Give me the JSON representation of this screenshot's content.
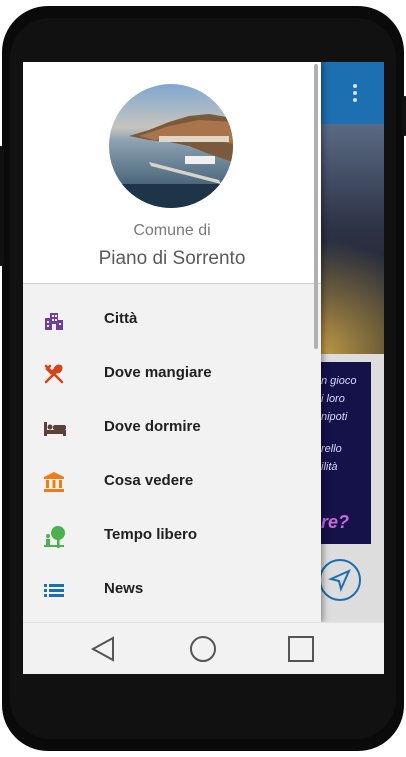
{
  "drawer": {
    "header": {
      "subtitle": "Comune di",
      "title": "Piano di Sorrento"
    },
    "items": [
      {
        "label": "Città",
        "icon": "buildings-icon",
        "color": "#6a3fa0"
      },
      {
        "label": "Dove mangiare",
        "icon": "fork-spoon-icon",
        "color": "#d84315"
      },
      {
        "label": "Dove dormire",
        "icon": "bed-icon",
        "color": "#5d4037"
      },
      {
        "label": "Cosa vedere",
        "icon": "museum-icon",
        "color": "#ef7d14"
      },
      {
        "label": "Tempo libero",
        "icon": "park-icon",
        "color": "#4caf50"
      },
      {
        "label": "News",
        "icon": "list-icon",
        "color": "#1c6fb0"
      }
    ]
  },
  "background": {
    "card_text_lines": [
      "n gioco",
      "i loro",
      "nipoti",
      "rello",
      "ilità"
    ],
    "card_big_text": "re?"
  },
  "navbar": {
    "back": "back-icon",
    "home": "home-icon",
    "recents": "recents-icon"
  }
}
